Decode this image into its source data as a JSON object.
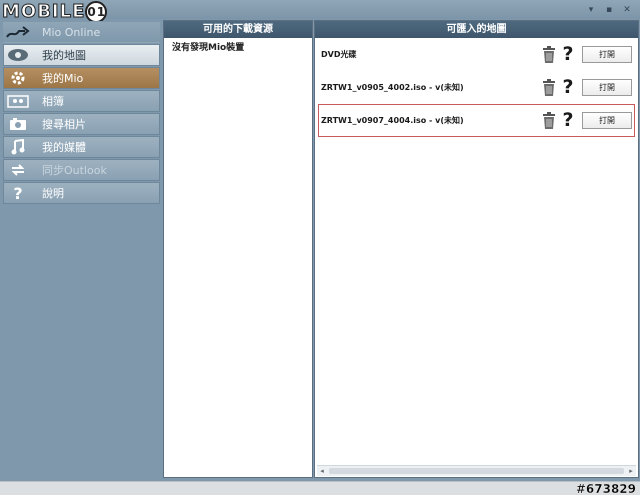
{
  "logo": {
    "text": "MOBILE",
    "num": "01"
  },
  "window_controls": [
    "▾",
    "▪",
    "✕"
  ],
  "sidebar": {
    "items": [
      {
        "label": "Mio Online",
        "icon": "mio-online-icon"
      },
      {
        "label": "我的地圖",
        "icon": "eye-icon"
      },
      {
        "label": "我的Mio",
        "icon": "gear-icon"
      },
      {
        "label": "相簿",
        "icon": "photos-icon"
      },
      {
        "label": "搜尋相片",
        "icon": "camera-icon"
      },
      {
        "label": "我的媒體",
        "icon": "music-note-icon"
      },
      {
        "label": "同步Outlook",
        "icon": "sync-icon"
      },
      {
        "label": "說明",
        "icon": "question-icon"
      }
    ]
  },
  "left_panel": {
    "header": "可用的下載資源",
    "items": [
      "沒有發現Mio裝置"
    ]
  },
  "right_panel": {
    "header": "可匯入的地圖",
    "rows": [
      {
        "name": "DVD光碟",
        "open_label": "打開"
      },
      {
        "name": "ZRTW1_v0905_4002.iso - v(未知)",
        "open_label": "打開"
      },
      {
        "name": "ZRTW1_v0907_4004.iso - v(未知)",
        "open_label": "打開"
      }
    ],
    "help_glyph": "?"
  },
  "watermark": "#673829"
}
